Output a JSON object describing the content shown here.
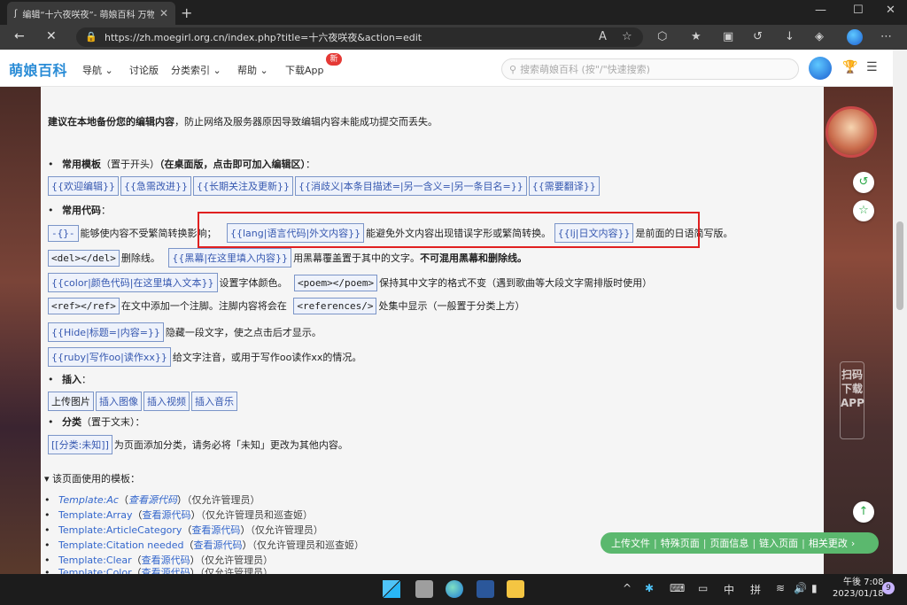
{
  "browser": {
    "tab_title": "编辑“十六夜咲夜”- 萌娘百科 万物",
    "tab_close": "✕",
    "new_tab": "+",
    "url": "https://zh.moegirl.org.cn/index.php?title=十六夜咲夜&action=edit",
    "minimize": "—",
    "maximize": "☐",
    "close": "✕"
  },
  "site": {
    "logo": "萌娘百科",
    "menu": [
      "导航 ⌄",
      "讨论版",
      "分类索引 ⌄",
      "帮助 ⌄",
      "下载App"
    ],
    "new_badge": "新",
    "search_placeholder": "搜索萌娘百科 (按\"/\"快速搜索)"
  },
  "content": {
    "notice_bold": "建议在本地备份您的编辑内容",
    "notice_rest": "，防止网络及服务器原因导致编辑内容未能成功提交而丢失。",
    "templates_label": "常用模板",
    "templates_note": "（置于开头）",
    "templates_note2": "（在桌面版，点击即可加入编辑区）",
    "templates_colon": "：",
    "templates": [
      "{{欢迎编辑}}",
      "{{急需改进}}",
      "{{长期关注及更新}}",
      "{{消歧义|本条目描述=|另一含义=|另一条目名=}}",
      "{{需要翻译}}"
    ],
    "code_label": "常用代码",
    "code_colon": "：",
    "code_rows": [
      {
        "chip1": "-{}-",
        "text1": "能够使内容不受繁简转换影响；",
        "chip2": "{{lang|语言代码|外文内容}}",
        "text2": "能避免外文内容出现错误字形或繁简转换。",
        "chip3": "{{lj|日文内容}}",
        "text3": "是前面的日语简写版。"
      },
      {
        "chip1": "<del></del>",
        "text1": "删除线。",
        "chip2": "{{黑幕|在这里填入内容}}",
        "text2": "用黑幕覆盖置于其中的文字。",
        "bold": "不可混用黑幕和删除线。"
      },
      {
        "chip1": "{{color|颜色代码|在这里填入文本}}",
        "text1": "设置字体颜色。",
        "chip2": "<poem></poem>",
        "text2": "保持其中文字的格式不变（遇到歌曲等大段文字需排版时使用）"
      },
      {
        "chip1": "<ref></ref>",
        "text1": "在文中添加一个注脚。注脚内容将会在",
        "chip2": "<references/>",
        "text2": "处集中显示（一般置于分类上方）"
      },
      {
        "chip1": "{{Hide|标题=|内容=}}",
        "text1": "隐藏一段文字，使之点击后才显示。"
      },
      {
        "chip1": "{{ruby|写作oo|读作xx}}",
        "text1": "给文字注音，或用于写作oo读作xx的情况。"
      }
    ],
    "insert_label": "插入",
    "insert_colon": "：",
    "insert_buttons": [
      "上传图片",
      "插入图像",
      "插入视频",
      "插入音乐"
    ],
    "category_label": "分类",
    "category_note": "（置于文末）：",
    "category_chip": "[[分类:未知]]",
    "category_text": "为页面添加分类，请务必将「未知」更改为其他内容。",
    "used_templates_header": "该页面使用的模板：",
    "used_templates": [
      {
        "name": "Template:Ac",
        "italic": true,
        "src": "查看源代码",
        "note": "（仅允许管理员）"
      },
      {
        "name": "Template:Array",
        "italic": false,
        "src": "查看源代码",
        "note": "（仅允许管理员和巡查姬）"
      },
      {
        "name": "Template:ArticleCategory",
        "italic": false,
        "src": "查看源代码",
        "note": "（仅允许管理员）"
      },
      {
        "name": "Template:Citation needed",
        "italic": false,
        "src": "查看源代码",
        "note": "（仅允许管理员和巡查姬）"
      },
      {
        "name": "Template:Clear",
        "italic": false,
        "src": "查看源代码",
        "note": "（仅允许管理员）"
      },
      {
        "name": "Template:Color",
        "italic": false,
        "src": "查看源代码",
        "note": "（仅允许管理员）"
      }
    ]
  },
  "side": {
    "app_text": "扫码下载APP",
    "tools": [
      "上传文件",
      "特殊页面",
      "页面信息",
      "链入页面",
      "相关更改"
    ],
    "tools_sep": "|",
    "tools_arrow": "›"
  },
  "taskbar": {
    "tray_caret": "^",
    "ime_1": "中",
    "ime_2": "拼",
    "time": "午後 7:08",
    "date": "2023/01/18",
    "notif": "9"
  }
}
